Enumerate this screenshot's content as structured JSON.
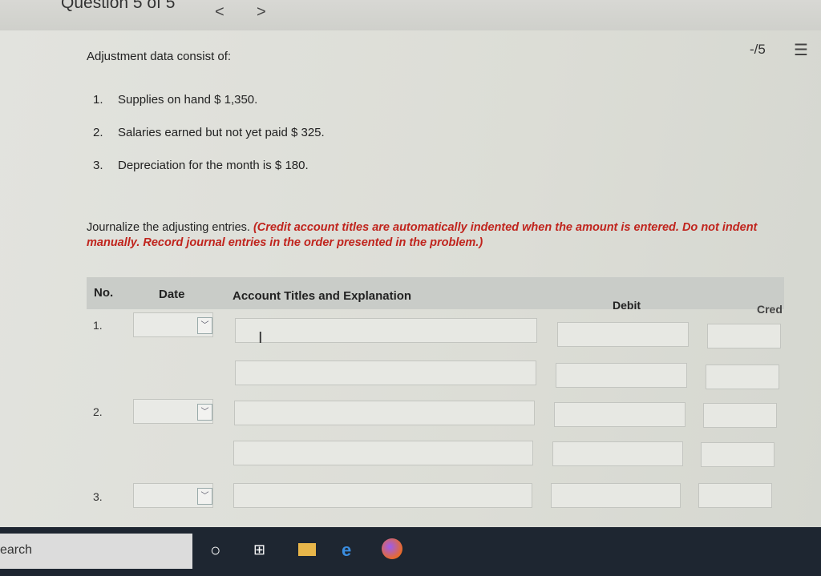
{
  "header": {
    "question_label": "Question 5 of 5",
    "prev_glyph": "<",
    "next_glyph": ">"
  },
  "score": {
    "text": "-/5",
    "list_icon": "list-icon"
  },
  "problem": {
    "headline": "Adjustment data consist of:",
    "items": [
      {
        "num": "1.",
        "text": "Supplies on hand $ 1,350."
      },
      {
        "num": "2.",
        "text": "Salaries earned but not yet paid $ 325."
      },
      {
        "num": "3.",
        "text": "Depreciation for the month is $ 180."
      }
    ]
  },
  "instructions": {
    "lead": "Journalize the adjusting entries. ",
    "note": "(Credit account titles are automatically indented when the amount is entered. Do not indent manually. Record journal entries in the order presented in the problem.)"
  },
  "table": {
    "headers": {
      "no": "No.",
      "date": "Date",
      "account": "Account Titles and Explanation",
      "debit": "Debit",
      "credit": "Cred"
    },
    "rows": [
      {
        "no": "1.",
        "date": "",
        "account": "",
        "debit": "",
        "credit": ""
      },
      {
        "no": "2.",
        "date": "",
        "account": "",
        "debit": "",
        "credit": ""
      },
      {
        "no": "3.",
        "date": "",
        "account": "",
        "debit": "",
        "credit": ""
      }
    ],
    "colors": {
      "header_bg": "#c9ccc8",
      "note_red": "#c0241d"
    }
  },
  "taskbar": {
    "search_text": "earch",
    "icons": [
      "cortana-icon",
      "task-view-icon",
      "file-explorer-icon",
      "edge-icon",
      "firefox-icon"
    ]
  }
}
